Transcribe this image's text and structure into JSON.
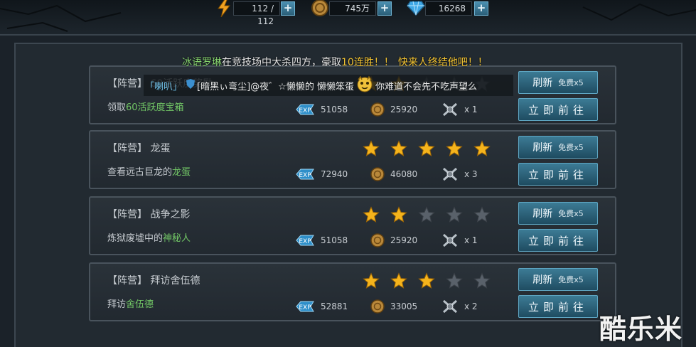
{
  "resources": {
    "stamina": "112 / 112",
    "gold": "745万",
    "diamond": "16268"
  },
  "broadcast": {
    "line1_part1": "冰语罗琳",
    "line1_part2": "在竞技场中大杀四方，豪取",
    "line1_part3": "10连胜！！",
    "line1_part4": "快来人终结他吧！！",
    "line2_channel": "「喇叭」",
    "line2_user": "[暗黑ぃ弯尘]@夜゛☆懒懒的 懒懒笨蛋",
    "line2_text": "你难道不会先不吃声望么"
  },
  "quests": [
    {
      "title": "【阵营】 60活跃度奖励",
      "desc_prefix": "领取",
      "desc_highlight": "60活跃度宝箱",
      "desc_suffix": "",
      "stars": 2,
      "exp": "51058",
      "coins": "25920",
      "items": "x 1",
      "refresh_label": "刷新",
      "refresh_free": "免费x5",
      "go_label": "立即前往"
    },
    {
      "title": "【阵营】 龙蛋",
      "desc_prefix": "查看远古巨龙的",
      "desc_highlight": "龙蛋",
      "desc_suffix": "",
      "stars": 5,
      "exp": "72940",
      "coins": "46080",
      "items": "x 3",
      "refresh_label": "刷新",
      "refresh_free": "免费x5",
      "go_label": "立即前往"
    },
    {
      "title": "【阵营】 战争之影",
      "desc_prefix": "炼狱废墟中的",
      "desc_highlight": "神秘人",
      "desc_suffix": "",
      "stars": 2,
      "exp": "51058",
      "coins": "25920",
      "items": "x 1",
      "refresh_label": "刷新",
      "refresh_free": "免费x5",
      "go_label": "立即前往"
    },
    {
      "title": "【阵营】 拜访舍伍德",
      "desc_prefix": "拜访",
      "desc_highlight": "舍伍德",
      "desc_suffix": "",
      "stars": 3,
      "exp": "52881",
      "coins": "33005",
      "items": "x 2",
      "refresh_label": "刷新",
      "refresh_free": "免费x5",
      "go_label": "立即前往"
    }
  ],
  "watermark": "酷乐米",
  "colors": {
    "accent_green": "#72c766",
    "star_gold": "#f5b41c",
    "button_blue": "#2f6a83"
  }
}
